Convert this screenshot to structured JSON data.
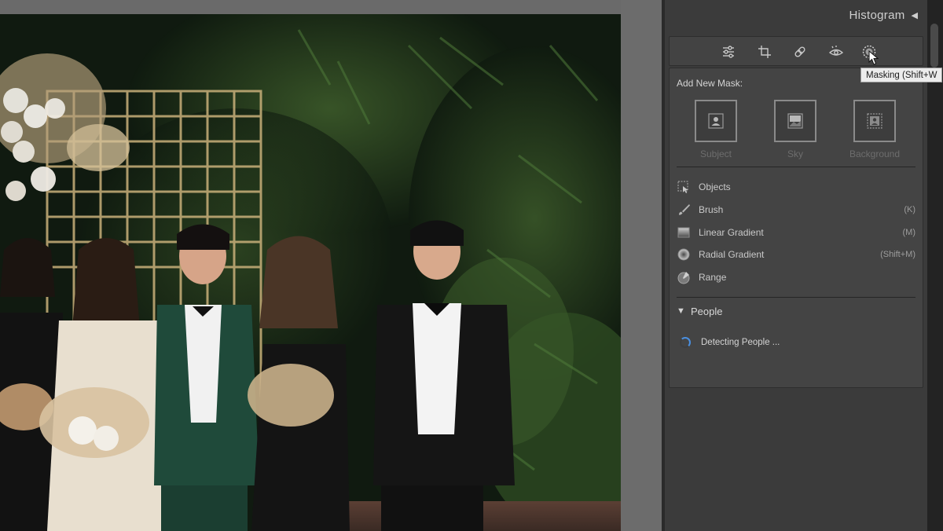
{
  "panel": {
    "histogram_title": "Histogram",
    "collapse_glyph": "◀",
    "tooltip": "Masking (Shift+W",
    "toolstrip": [
      {
        "name": "edit-sliders-icon",
        "label": "Edit"
      },
      {
        "name": "crop-icon",
        "label": "Crop"
      },
      {
        "name": "healing-icon",
        "label": "Healing"
      },
      {
        "name": "red-eye-icon",
        "label": "Red Eye"
      },
      {
        "name": "masking-icon",
        "label": "Masking"
      }
    ],
    "add_new_mask": "Add New Mask:",
    "mask_tiles": [
      {
        "label": "Subject",
        "icon": "subject-icon"
      },
      {
        "label": "Sky",
        "icon": "sky-icon"
      },
      {
        "label": "Background",
        "icon": "background-icon"
      }
    ],
    "tools": [
      {
        "label": "Objects",
        "shortcut": "",
        "icon": "objects-icon"
      },
      {
        "label": "Brush",
        "shortcut": "(K)",
        "icon": "brush-icon"
      },
      {
        "label": "Linear Gradient",
        "shortcut": "(M)",
        "icon": "linear-gradient-icon"
      },
      {
        "label": "Radial Gradient",
        "shortcut": "(Shift+M)",
        "icon": "radial-gradient-icon"
      },
      {
        "label": "Range",
        "shortcut": "",
        "icon": "range-icon"
      }
    ],
    "people_section": {
      "label": "People",
      "status": "Detecting People ..."
    }
  },
  "colors": {
    "panel_bg": "#3b3b3b",
    "section_bg": "#444444",
    "accent_spinner": "#4a8fe0",
    "canvas_bg": "#606060"
  }
}
